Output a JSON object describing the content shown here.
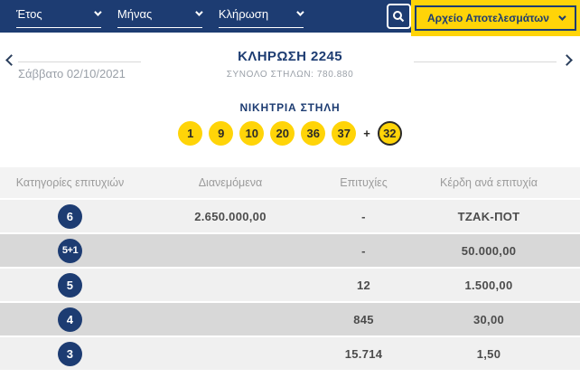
{
  "toolbar": {
    "year_label": "Έτος",
    "month_label": "Μήνας",
    "draw_label": "Κλήρωση",
    "archive_button_label": "Αρχείο Αποτελεσμάτων"
  },
  "draw_header": {
    "title": "ΚΛΗΡΩΣΗ 2245",
    "subtitle": "ΣΥΝΟΛΟ ΣΤΗΛΩΝ: 780.880",
    "date": "Σάββατο 02/10/2021"
  },
  "winning": {
    "title": "ΝΙΚΗΤΡΙΑ ΣΤΗΛΗ",
    "numbers": [
      "1",
      "9",
      "10",
      "20",
      "36",
      "37"
    ],
    "plus": "+",
    "joker": "32"
  },
  "table": {
    "headers": [
      "Κατηγορίες επιτυχιών",
      "Διανεμόμενα",
      "Επιτυχίες",
      "Κέρδη ανά επιτυχία"
    ],
    "rows": [
      {
        "category": "6",
        "distributed": "2.650.000,00",
        "wins": "-",
        "prize": "ΤΖΑΚ-ΠΟΤ"
      },
      {
        "category": "5+1",
        "distributed": "",
        "wins": "-",
        "prize": "50.000,00"
      },
      {
        "category": "5",
        "distributed": "",
        "wins": "12",
        "prize": "1.500,00"
      },
      {
        "category": "4",
        "distributed": "",
        "wins": "845",
        "prize": "30,00"
      },
      {
        "category": "3",
        "distributed": "",
        "wins": "15.714",
        "prize": "1,50"
      }
    ]
  },
  "colors": {
    "navy": "#1d3c72",
    "yellow": "#ffd408",
    "row_light": "#f0f0f0",
    "row_dark": "#d8d8d8",
    "text_gray": "#9b9b9b"
  }
}
